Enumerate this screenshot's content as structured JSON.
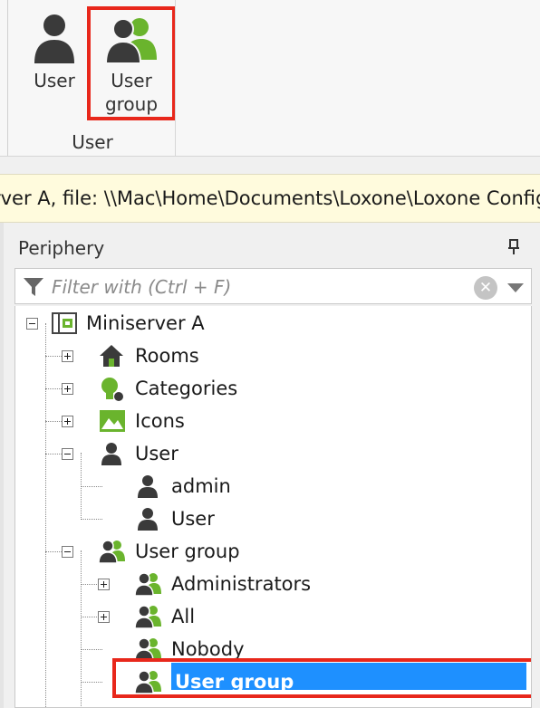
{
  "ribbon": {
    "user_button_label": "User",
    "user_group_button_line1": "User",
    "user_group_button_line2": "group",
    "group_caption": "User"
  },
  "status_bar": {
    "text": "rver A, file: \\\\Mac\\Home\\Documents\\Loxone\\Loxone Config"
  },
  "periphery": {
    "title": "Periphery",
    "filter_placeholder": "Filter with (Ctrl + F)",
    "tree": {
      "root": "Miniserver A",
      "rooms": "Rooms",
      "categories": "Categories",
      "icons": "Icons",
      "user": "User",
      "user_children": [
        "admin",
        "User"
      ],
      "user_group": "User group",
      "user_group_children": [
        "Administrators",
        "All",
        "Nobody",
        "User group"
      ]
    }
  },
  "colors": {
    "accent_red": "#e8271b",
    "selection_blue": "#1e90ff",
    "icon_green": "#6ab42d",
    "icon_dark": "#3a3a3a"
  }
}
